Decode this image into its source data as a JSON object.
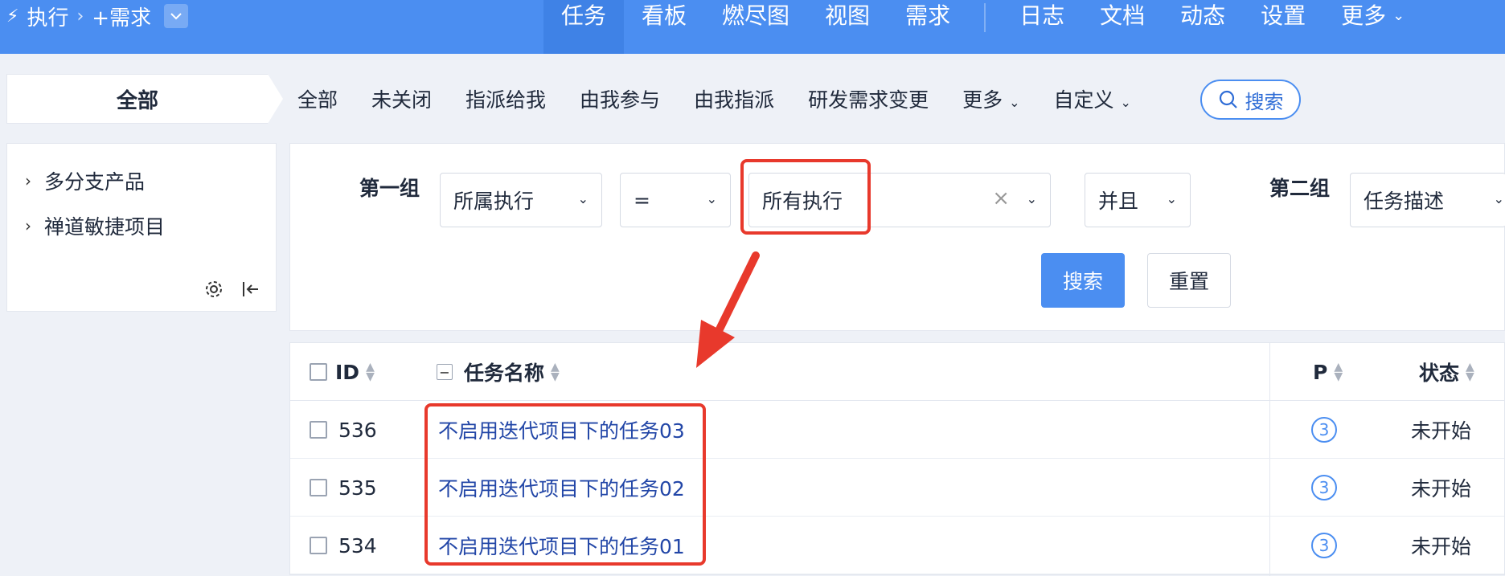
{
  "topbar": {
    "breadcrumb": [
      "执行",
      "+需求"
    ],
    "nav": [
      {
        "label": "任务",
        "active": true
      },
      {
        "label": "看板"
      },
      {
        "label": "燃尽图"
      },
      {
        "label": "视图"
      },
      {
        "label": "需求"
      },
      {
        "label": "日志"
      },
      {
        "label": "文档"
      },
      {
        "label": "动态"
      },
      {
        "label": "设置"
      },
      {
        "label": "更多"
      }
    ]
  },
  "tab_all": "全部",
  "filters": [
    "全部",
    "未关闭",
    "指派给我",
    "由我参与",
    "由我指派",
    "研发需求变更",
    "更多",
    "自定义"
  ],
  "search_button": "搜索",
  "sidebar": {
    "items": [
      "多分支产品",
      "禅道敏捷项目"
    ]
  },
  "search_panel": {
    "group1_label": "第一组",
    "field": "所属执行",
    "operator": "=",
    "value": "所有执行",
    "logic": "并且",
    "group2_label": "第二组",
    "field2": "任务描述",
    "search": "搜索",
    "reset": "重置"
  },
  "table": {
    "headers": {
      "id": "ID",
      "name": "任务名称",
      "pri": "P",
      "status": "状态"
    },
    "rows": [
      {
        "id": "536",
        "name": "不启用迭代项目下的任务03",
        "pri": "3",
        "status": "未开始"
      },
      {
        "id": "535",
        "name": "不启用迭代项目下的任务02",
        "pri": "3",
        "status": "未开始"
      },
      {
        "id": "534",
        "name": "不启用迭代项目下的任务01",
        "pri": "3",
        "status": "未开始"
      }
    ]
  },
  "colors": {
    "primary": "#4b8ef1",
    "annotation": "#e8392c",
    "link": "#2246a7"
  }
}
